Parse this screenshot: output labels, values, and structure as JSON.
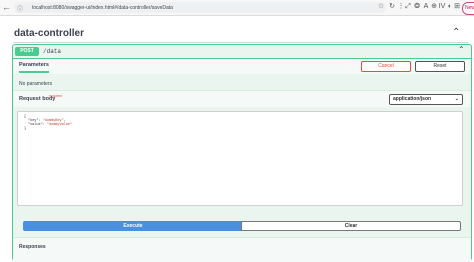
{
  "browser": {
    "back": "←",
    "url": "localhost:8080/swagger-ui/index.html#/data-controller/saveData",
    "toolbar_icons": [
      "☆",
      "↻",
      "⋮",
      "⤢",
      "❂",
      "A",
      "⊕",
      "IV",
      "◐",
      "⊞"
    ],
    "profile_label": "New"
  },
  "controller": {
    "name": "data-controller"
  },
  "operation": {
    "method": "POST",
    "path": "/data",
    "tab_params": "Parameters",
    "cancel_label": "Cancel",
    "reset_label": "Reset",
    "no_params": "No parameters",
    "request_body_label": "Request body",
    "required_label": "required",
    "content_type": "application/json",
    "body_lines": {
      "open": "{",
      "key_line_key": "\"key\": ",
      "key_line_val": "\"dummyKey\",",
      "value_line_key": "\"value\": ",
      "value_line_val": "\"dummyValue\"",
      "close": "}"
    },
    "execute_label": "Execute",
    "clear_label": "Clear",
    "responses_label": "Responses"
  },
  "colors": {
    "post_green": "#49cc90",
    "execute_blue": "#4990e2",
    "cancel_red": "#e74c3c"
  }
}
